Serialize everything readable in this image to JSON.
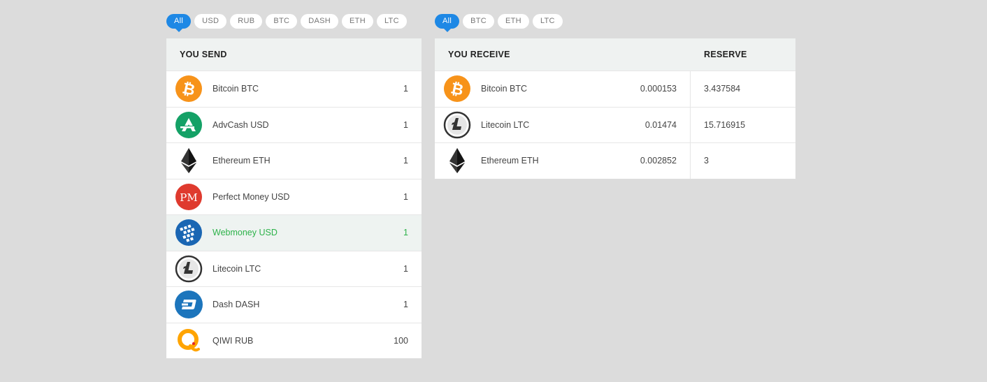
{
  "send_filters": [
    {
      "label": "All",
      "active": true
    },
    {
      "label": "USD"
    },
    {
      "label": "RUB"
    },
    {
      "label": "BTC"
    },
    {
      "label": "DASH"
    },
    {
      "label": "ETH"
    },
    {
      "label": "LTC"
    }
  ],
  "receive_filters": [
    {
      "label": "All",
      "active": true
    },
    {
      "label": "BTC"
    },
    {
      "label": "ETH"
    },
    {
      "label": "LTC"
    }
  ],
  "send": {
    "header": "YOU SEND",
    "rows": [
      {
        "name": "Bitcoin BTC",
        "amount": "1",
        "icon": "bitcoin-icon"
      },
      {
        "name": "AdvCash USD",
        "amount": "1",
        "icon": "advcash-icon"
      },
      {
        "name": "Ethereum ETH",
        "amount": "1",
        "icon": "ethereum-icon"
      },
      {
        "name": "Perfect Money USD",
        "amount": "1",
        "icon": "perfect-money-icon"
      },
      {
        "name": "Webmoney USD",
        "amount": "1",
        "icon": "webmoney-icon",
        "selected": true
      },
      {
        "name": "Litecoin LTC",
        "amount": "1",
        "icon": "litecoin-icon"
      },
      {
        "name": "Dash DASH",
        "amount": "1",
        "icon": "dash-icon"
      },
      {
        "name": "QIWI RUB",
        "amount": "100",
        "icon": "qiwi-icon"
      }
    ]
  },
  "receive": {
    "header": "YOU RECEIVE",
    "reserve_header": "RESERVE",
    "rows": [
      {
        "name": "Bitcoin BTC",
        "rate": "0.000153",
        "reserve": "3.437584",
        "icon": "bitcoin-icon"
      },
      {
        "name": "Litecoin LTC",
        "rate": "0.01474",
        "reserve": "15.716915",
        "icon": "litecoin-icon"
      },
      {
        "name": "Ethereum ETH",
        "rate": "0.002852",
        "reserve": "3",
        "icon": "ethereum-icon"
      }
    ]
  },
  "colors": {
    "accent": "#1e88e5",
    "selected_text": "#2db24a",
    "header_bg": "#eff2f1",
    "page_bg": "#dcdcdc"
  }
}
